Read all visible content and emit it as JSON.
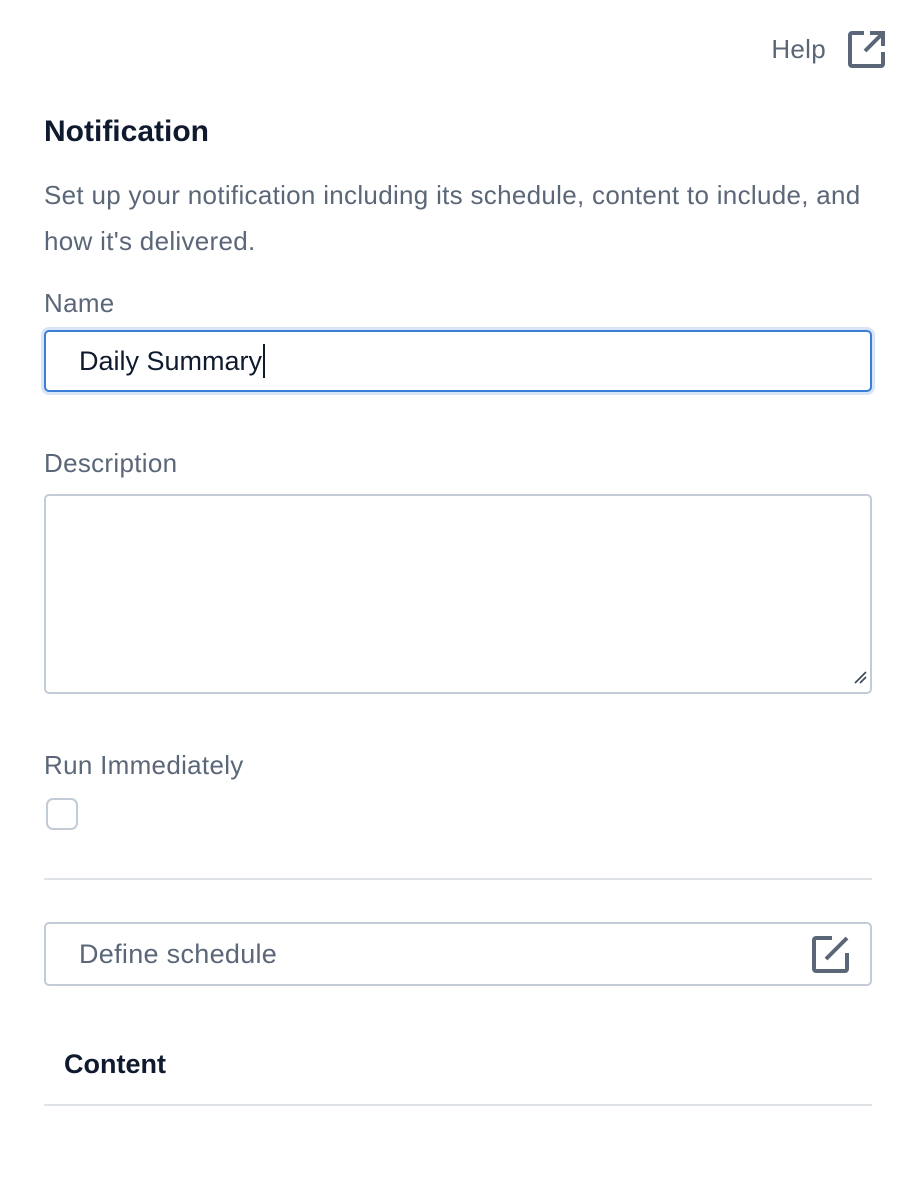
{
  "header": {
    "help_label": "Help",
    "help_icon": "external-link-icon"
  },
  "panel": {
    "title": "Notification",
    "subtitle": "Set up your notification including its schedule, content to include, and how it's delivered."
  },
  "form": {
    "name": {
      "label": "Name",
      "value": "Daily Summary"
    },
    "description": {
      "label": "Description",
      "value": ""
    },
    "run_immediately": {
      "label": "Run Immediately",
      "checked": false
    },
    "schedule": {
      "label": "Define schedule",
      "icon": "edit-icon"
    },
    "content": {
      "label": "Content"
    }
  },
  "colors": {
    "text_primary": "#0f1a2e",
    "text_secondary": "#5b6778",
    "focus_border": "#3a7fd5",
    "input_border": "#c3cbd6",
    "divider": "#dfe3e8"
  }
}
